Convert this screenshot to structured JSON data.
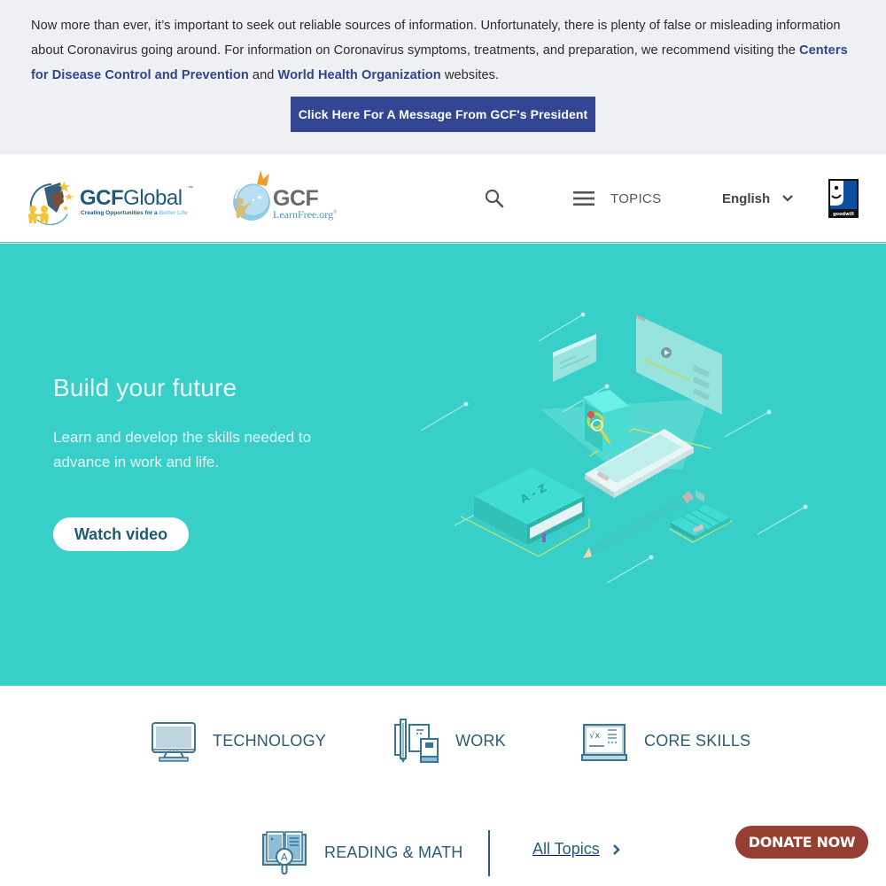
{
  "alert": {
    "text_part1": "Now more than ever, it’s important to seek out reliable sources of information. Unfortunately, there is plenty of false or misleading information about Coronavirus going around. For information on Coronavirus symptoms, treatments, and preparation, we recommend visiting the ",
    "link_cdc": "Centers for Disease Control and Prevention",
    "text_and": " and ",
    "link_who": "World Health Organization",
    "text_end": " websites.",
    "button_label": "Click Here For A Message From GCF's President"
  },
  "header": {
    "logo_gcfglobal": {
      "title_bold": "GCF",
      "title_regular": "Global",
      "trademark": "™",
      "tagline_prefix": "Creating Opportunities for a ",
      "tagline_highlight": "Better Life"
    },
    "logo_learnfree": {
      "title": "GCF",
      "subtitle": "LearnFree.org",
      "registered": "®"
    },
    "search_icon": "search-icon",
    "topics_label": "TOPICS",
    "language_selected": "English",
    "partner_logo": "goodwill"
  },
  "hero": {
    "title": "Build your future",
    "subtitle": "Learn and develop the skills needed to advance in work and life.",
    "button_label": "Watch video",
    "illustration_book_label": "A - Z"
  },
  "topics": {
    "items": [
      {
        "label": "TECHNOLOGY",
        "icon": "computer-monitor-icon"
      },
      {
        "label": "WORK",
        "icon": "pencil-books-icon"
      },
      {
        "label": "CORE SKILLS",
        "icon": "laptop-math-icon"
      },
      {
        "label": "READING & MATH",
        "icon": "open-book-magnifier-icon"
      }
    ],
    "all_topics_label": "All Topics"
  },
  "donate": {
    "label": "DONATE NOW"
  },
  "colors": {
    "alert_bg": "#eff0f3",
    "link": "#2e4790",
    "alert_button": "#324694",
    "hero_bg": "#38cfc8",
    "topic_text": "#2a5c76",
    "donate_bg": "#953f32"
  }
}
